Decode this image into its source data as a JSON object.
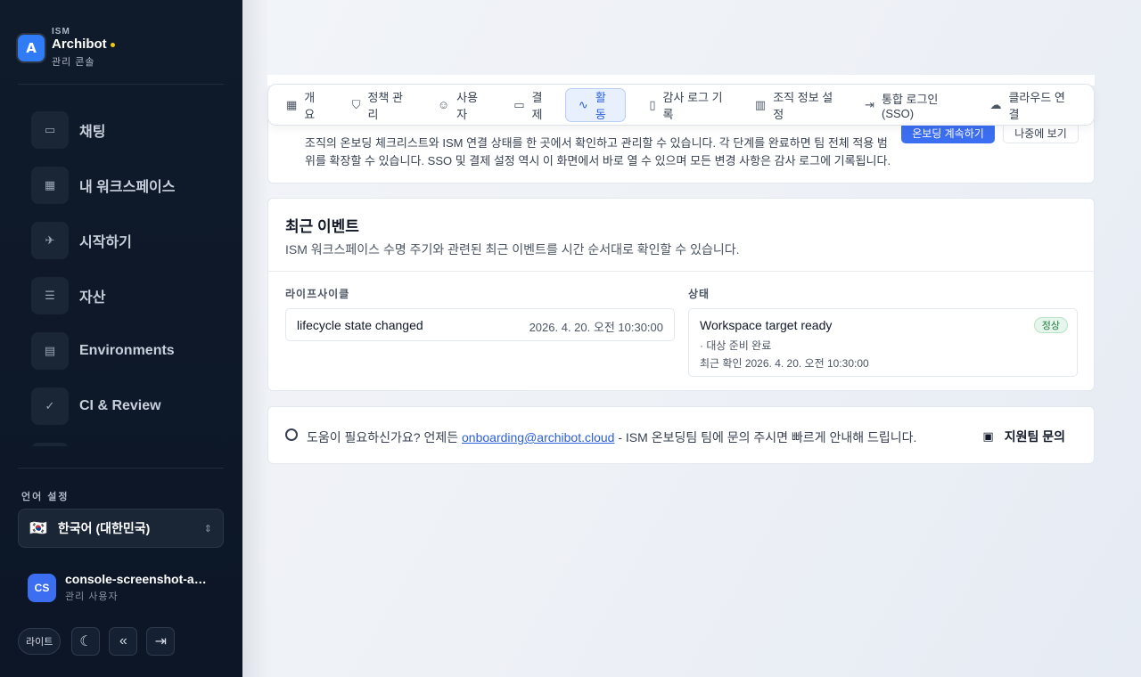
{
  "brand": {
    "tag": "ISM",
    "name": "Archibot",
    "subtitle": "관리 콘솔",
    "logo_letter": "A"
  },
  "sidebar": {
    "items": [
      {
        "icon": "chat-icon",
        "glyph": "▭",
        "label": "채팅"
      },
      {
        "icon": "grid-icon",
        "glyph": "▦",
        "label": "내 워크스페이스"
      },
      {
        "icon": "rocket-icon",
        "glyph": "✈",
        "label": "시작하기"
      },
      {
        "icon": "database-icon",
        "glyph": "☰",
        "label": "자산"
      },
      {
        "icon": "server-icon",
        "glyph": "▤",
        "label": "Environments"
      },
      {
        "icon": "check-circle-icon",
        "glyph": "✓",
        "label": "CI & Review"
      }
    ],
    "language_label": "언어 설정",
    "language_flag": "🇰🇷",
    "language_value": "한국어 (대한민국)",
    "user": {
      "initials": "CS",
      "name": "console-screenshot-admin",
      "role": "관리 사용자"
    },
    "bottom": {
      "pill_label": "라이트"
    }
  },
  "tabs": [
    {
      "icon": "grid-icon",
      "glyph": "▦",
      "label": "개요"
    },
    {
      "icon": "shield-icon",
      "glyph": "⛉",
      "label": "정책 관리"
    },
    {
      "icon": "users-icon",
      "glyph": "☺",
      "label": "사용자"
    },
    {
      "icon": "card-icon",
      "glyph": "▭",
      "label": "결제"
    },
    {
      "icon": "activity-icon",
      "glyph": "∿",
      "label": "활동"
    },
    {
      "icon": "receipt-icon",
      "glyph": "▯",
      "label": "감사 로그 기록"
    },
    {
      "icon": "building-icon",
      "glyph": "▥",
      "label": "조직 정보 설정"
    },
    {
      "icon": "login-icon",
      "glyph": "⇥",
      "label": "통합 로그인(SSO)"
    },
    {
      "icon": "cloud-icon",
      "glyph": "☁",
      "label": "클라우드 연결"
    }
  ],
  "top_card": {
    "description": "조직의 온보딩 체크리스트와 ISM 연결 상태를 한 곳에서 확인하고 관리할 수 있습니다. 각 단계를 완료하면 팀 전체 적용 범위를 확장할 수 있습니다. SSO 및 결제 설정 역시 이 화면에서 바로 열 수 있으며 모든 변경 사항은 감사 로그에 기록됩니다.",
    "primary_label": "온보딩 계속하기",
    "secondary_label": "나중에 보기"
  },
  "events": {
    "title": "최근 이벤트",
    "description": "ISM 워크스페이스 수명 주기와 관련된 최근 이벤트를 시간 순서대로 확인할 수 있습니다.",
    "left_label": "라이프사이클",
    "right_label": "상태",
    "event_name": "lifecycle state changed",
    "event_time": "2026. 4. 20. 오전 10:30:00",
    "ws_title": "Workspace target ready",
    "ws_badge": "정상",
    "ws_detail": "· 대상 준비 완료",
    "ws_time": "최근 확인 2026. 4. 20. 오전 10:30:00"
  },
  "help": {
    "prefix": "도움이 필요하신가요? 언제든",
    "email": "onboarding@archibot.cloud",
    "suffix": "- ISM 온보딩팀 팀에 문의 주시면 빠르게 안내해 드립니다.",
    "button_label": "지원팀 문의"
  }
}
